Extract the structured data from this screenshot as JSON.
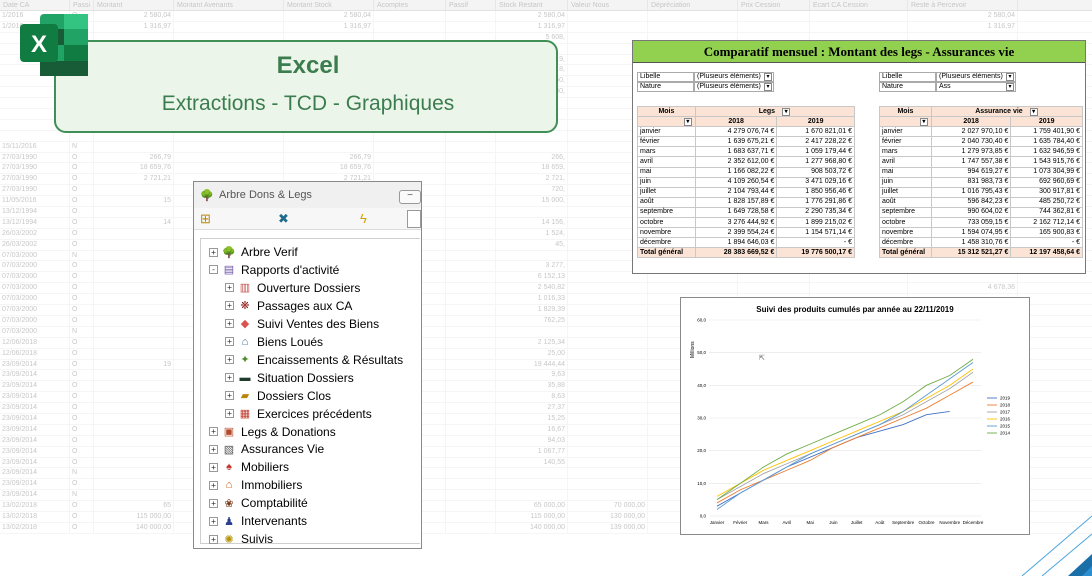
{
  "background_sheet": {
    "headers": [
      "Date CA",
      "Passi",
      "Montant",
      "Montant Avenants",
      "Montant Stock",
      "Acomptes",
      "Passif",
      "Stock Restant",
      "Valeur Nous",
      "Dépréciation",
      "Prix Cession",
      "Ecart CA Cession",
      "Reste à Percevoir"
    ],
    "rows": [
      [
        "1/2016",
        "O",
        "2 580,04",
        "",
        "2 580,04",
        "",
        "",
        "2 580,04",
        "",
        "",
        "",
        "",
        "2 580,04"
      ],
      [
        "1/2016",
        "O",
        "1 316,97",
        "",
        "1 316,97",
        "",
        "",
        "1 316,97",
        "",
        "",
        "",
        "",
        "1 316,97"
      ],
      [
        "",
        "",
        "",
        "",
        "",
        "",
        "",
        "5 608,",
        "",
        "",
        "",
        "",
        ""
      ],
      [
        "",
        "",
        "",
        "",
        "",
        "",
        "",
        "",
        "",
        "",
        "",
        "",
        ""
      ],
      [
        "",
        "",
        "",
        "",
        "",
        "",
        "",
        "19,",
        "",
        "",
        "",
        "",
        ""
      ],
      [
        "",
        "",
        "",
        "",
        "",
        "",
        "",
        "8,",
        "",
        "",
        "",
        "",
        ""
      ],
      [
        "",
        "",
        "",
        "",
        "",
        "",
        "",
        "850,",
        "",
        "",
        "",
        "",
        ""
      ],
      [
        "",
        "",
        "",
        "",
        "",
        "",
        "",
        "530,",
        "",
        "",
        "",
        "",
        ""
      ],
      [
        "",
        "",
        "",
        "",
        "",
        "",
        "",
        "",
        "",
        "",
        "",
        "",
        ""
      ],
      [
        "",
        "",
        "",
        "",
        "",
        "",
        "",
        "",
        "",
        "",
        "",
        "",
        ""
      ],
      [
        "",
        "",
        "",
        "",
        "",
        "",
        "",
        "",
        "",
        "",
        "",
        "",
        ""
      ],
      [
        "",
        "",
        "",
        "",
        "",
        "",
        "",
        "",
        "",
        "",
        "",
        "",
        ""
      ],
      [
        "15/11/2016",
        "N",
        "",
        "",
        "",
        "",
        "",
        "",
        "",
        "",
        "",
        "",
        ""
      ],
      [
        "27/03/1990",
        "O",
        "266,79",
        "",
        "266,79",
        "",
        "",
        "266,",
        "",
        "",
        "",
        "",
        ""
      ],
      [
        "27/03/1990",
        "O",
        "18 659,76",
        "",
        "18 659,76",
        "",
        "",
        "18 659,",
        "",
        "",
        "",
        "",
        ""
      ],
      [
        "27/03/1990",
        "O",
        "2 721,21",
        "",
        "2 721,21",
        "",
        "",
        "2 721,",
        "",
        "",
        "",
        "",
        ""
      ],
      [
        "27/03/1990",
        "O",
        "",
        "",
        "",
        "",
        "",
        "720,",
        "",
        "",
        "",
        "",
        ""
      ],
      [
        "11/05/2016",
        "O",
        "15",
        "",
        "",
        "",
        "",
        "15 000,",
        "",
        "",
        "",
        "",
        ""
      ],
      [
        "13/12/1994",
        "O",
        "",
        "",
        "",
        "",
        "",
        "",
        "",
        "",
        "",
        "",
        ""
      ],
      [
        "13/12/1994",
        "O",
        "14",
        "",
        "",
        "",
        "",
        "14 156,",
        "",
        "",
        "",
        "",
        ""
      ],
      [
        "26/03/2002",
        "O",
        "",
        "",
        "",
        "",
        "",
        "1 524,",
        "",
        "",
        "",
        "",
        ""
      ],
      [
        "26/03/2002",
        "O",
        "",
        "",
        "",
        "",
        "",
        "45,",
        "",
        "",
        "",
        "",
        ""
      ],
      [
        "07/03/2000",
        "N",
        "",
        "",
        "",
        "",
        "",
        "",
        "",
        "",
        "",
        "",
        ""
      ],
      [
        "07/03/2000",
        "O",
        "",
        "",
        "",
        "",
        "",
        "3 277,",
        "",
        "",
        "",
        "",
        ""
      ],
      [
        "07/03/2000",
        "O",
        "",
        "",
        "",
        "",
        "",
        "6 152,13",
        "",
        "",
        "",
        "",
        ""
      ],
      [
        "07/03/2000",
        "O",
        "",
        "",
        "",
        "",
        "",
        "2 540,82",
        "",
        "",
        "",
        "",
        "4 678,36"
      ],
      [
        "07/03/2000",
        "O",
        "",
        "",
        "",
        "",
        "",
        "1 016,33",
        "",
        "",
        "",
        "",
        ""
      ],
      [
        "07/03/2000",
        "O",
        "",
        "",
        "",
        "",
        "",
        "1 829,39",
        "",
        "",
        "",
        "",
        "3 562,55"
      ],
      [
        "07/03/2000",
        "O",
        "",
        "",
        "",
        "",
        "",
        "762,25",
        "",
        "",
        "",
        "",
        "1 930,45"
      ],
      [
        "07/03/2000",
        "N",
        "",
        "",
        "",
        "",
        "",
        "",
        "",
        "",
        "",
        "",
        "2 408,33"
      ],
      [
        "12/06/2018",
        "O",
        "",
        "",
        "",
        "",
        "",
        "2 125,34",
        "",
        "",
        "",
        "",
        "2 125,34"
      ],
      [
        "12/06/2018",
        "O",
        "",
        "",
        "",
        "",
        "",
        "25,00",
        "",
        "",
        "",
        "",
        ""
      ],
      [
        "23/09/2014",
        "O",
        "19",
        "",
        "",
        "",
        "",
        "19 444,44",
        "",
        "",
        "",
        "",
        "15 555,55"
      ],
      [
        "23/09/2014",
        "O",
        "",
        "",
        "",
        "",
        "",
        "9,63",
        "",
        "",
        "",
        "",
        "9,63"
      ],
      [
        "23/09/2014",
        "O",
        "",
        "",
        "",
        "",
        "",
        "35,88",
        "",
        "",
        "",
        "",
        "35,88"
      ],
      [
        "23/09/2014",
        "O",
        "",
        "",
        "",
        "",
        "",
        "8,63",
        "",
        "",
        "",
        "",
        "8,63"
      ],
      [
        "23/09/2014",
        "O",
        "",
        "",
        "",
        "",
        "",
        "27,37",
        "",
        "",
        "",
        "",
        "27,37"
      ],
      [
        "23/09/2014",
        "O",
        "",
        "",
        "",
        "",
        "",
        "15,25",
        "",
        "",
        "",
        "",
        "15,25"
      ],
      [
        "23/09/2014",
        "O",
        "",
        "",
        "",
        "",
        "",
        "16,67",
        "",
        "",
        "",
        "",
        "16,67"
      ],
      [
        "23/09/2014",
        "O",
        "",
        "",
        "",
        "",
        "",
        "94,03",
        "",
        "",
        "",
        "",
        "94,03"
      ],
      [
        "23/09/2014",
        "O",
        "",
        "",
        "",
        "",
        "",
        "1 067,77",
        "",
        "",
        "",
        "",
        "1 067,77"
      ],
      [
        "23/09/2014",
        "O",
        "",
        "",
        "",
        "",
        "",
        "140,55",
        "",
        "",
        "",
        "",
        "140,55"
      ],
      [
        "23/09/2014",
        "N",
        "",
        "",
        "",
        "",
        "",
        "",
        "",
        "",
        "",
        "",
        ""
      ],
      [
        "23/09/2014",
        "O",
        "",
        "",
        "",
        "",
        "",
        "",
        "",
        "",
        "",
        "",
        "4 873,37"
      ],
      [
        "23/09/2014",
        "N",
        "",
        "",
        "",
        "",
        "",
        "",
        "",
        "",
        "",
        "",
        ""
      ],
      [
        "13/02/2018",
        "O",
        "65",
        "",
        "",
        "",
        "",
        "65 000,00",
        "70 000,00",
        "",
        "",
        "",
        "70 000,00"
      ],
      [
        "13/02/2018",
        "O",
        "115 000,00",
        "",
        "115 000,00",
        "",
        "",
        "115 000,00",
        "130 000,00",
        "",
        "",
        "",
        "130 000,00"
      ],
      [
        "13/02/2018",
        "O",
        "140 000,00",
        "",
        "140 000,00",
        "",
        "",
        "140 000,00",
        "139 000,00",
        "",
        "1 000,00",
        "",
        "139 000,00"
      ]
    ]
  },
  "banner": {
    "title": "Excel",
    "subtitle": "Extractions - TCD - Graphiques",
    "icon_letter": "X",
    "icon": "excel-icon"
  },
  "comparatif": {
    "title": "Comparatif  mensuel : Montant des legs - Assurances vie",
    "left": {
      "filters": [
        {
          "label": "Libelle",
          "value": "(Plusieurs éléments)"
        },
        {
          "label": "Nature",
          "value": "(Plusieurs éléments)"
        }
      ],
      "col_mois": "Mois",
      "col_value": "Legs",
      "years": [
        "2018",
        "2019"
      ],
      "rows": [
        [
          "janvier",
          "4 279 076,74 €",
          "1 670 821,01 €"
        ],
        [
          "février",
          "1 639 675,21 €",
          "2 417 228,22 €"
        ],
        [
          "mars",
          "1 683 637,71 €",
          "1 059 179,44 €"
        ],
        [
          "avril",
          "2 352 612,00 €",
          "1 277 968,80 €"
        ],
        [
          "mai",
          "1 166 082,22 €",
          "908 503,72 €"
        ],
        [
          "juin",
          "4 109 260,54 €",
          "3 471 029,16 €"
        ],
        [
          "juillet",
          "2 104 793,44 €",
          "1 850 956,46 €"
        ],
        [
          "août",
          "1 828 157,89 €",
          "1 776 291,86 €"
        ],
        [
          "septembre",
          "1 649 728,58 €",
          "2 290 735,34 €"
        ],
        [
          "octobre",
          "3 276 444,92 €",
          "1 899 215,02 €"
        ],
        [
          "novembre",
          "2 399 554,24 €",
          "1 154 571,14 €"
        ],
        [
          "décembre",
          "1 894 646,03 €",
          "-   €"
        ]
      ],
      "total_label": "Total général",
      "totals": [
        "28 383 669,52 €",
        "19 776 500,17 €"
      ]
    },
    "right": {
      "filters": [
        {
          "label": "Libelle",
          "value": "(Plusieurs éléments)"
        },
        {
          "label": "Nature",
          "value": "Ass"
        }
      ],
      "col_mois": "Mois",
      "col_value": "Assurance vie",
      "years": [
        "2018",
        "2019"
      ],
      "rows": [
        [
          "janvier",
          "2 027 970,10 €",
          "1 759 401,90 €"
        ],
        [
          "février",
          "2 040 730,40 €",
          "1 635 784,40 €"
        ],
        [
          "mars",
          "1 279 973,85 €",
          "1 632 946,59 €"
        ],
        [
          "avril",
          "1 747 557,38 €",
          "1 543 915,76 €"
        ],
        [
          "mai",
          "994 619,27 €",
          "1 073 304,99 €"
        ],
        [
          "juin",
          "831 983,73 €",
          "692 960,69 €"
        ],
        [
          "juillet",
          "1 016 795,43 €",
          "300 917,81 €"
        ],
        [
          "août",
          "596 842,23 €",
          "485 250,72 €"
        ],
        [
          "septembre",
          "990 604,02 €",
          "744 362,81 €"
        ],
        [
          "octobre",
          "733 059,15 €",
          "2 162 712,14 €"
        ],
        [
          "novembre",
          "1 594 074,95 €",
          "165 900,83 €"
        ],
        [
          "décembre",
          "1 458 310,76 €",
          "-   €"
        ]
      ],
      "total_label": "Total général",
      "totals": [
        "15 312 521,27 €",
        "12 197 458,64 €"
      ]
    }
  },
  "chart_data": {
    "type": "line",
    "title": "Suivi des produits cumulés par année au 22/11/2019",
    "ylabel": "Millions",
    "xlabel": "",
    "categories": [
      "Janvier",
      "Février",
      "Mars",
      "Avril",
      "Mai",
      "Juin",
      "Juillet",
      "Août",
      "Septembre",
      "Octobre",
      "Novembre",
      "Décembre"
    ],
    "ylim": [
      0,
      60
    ],
    "yticks": [
      "0,0",
      "10,0",
      "20,0",
      "30,0",
      "40,0",
      "50,0",
      "60,0"
    ],
    "legend_position": "right",
    "series": [
      {
        "name": "2019",
        "color": "#4472c4",
        "values": [
          3,
          7,
          11,
          15,
          18,
          21,
          24,
          26,
          28,
          31,
          32,
          null
        ]
      },
      {
        "name": "2018",
        "color": "#ed7d31",
        "values": [
          4,
          8,
          11,
          14,
          17,
          21,
          24,
          27,
          30,
          33,
          37,
          41
        ]
      },
      {
        "name": "2017",
        "color": "#a5a5a5",
        "values": [
          5,
          9,
          13,
          16,
          19,
          22,
          25,
          28,
          31,
          35,
          39,
          44
        ]
      },
      {
        "name": "2016",
        "color": "#ffc000",
        "values": [
          6,
          10,
          14,
          17,
          20,
          23,
          26,
          29,
          32,
          36,
          40,
          45
        ]
      },
      {
        "name": "2015",
        "color": "#5b9bd5",
        "values": [
          2,
          7,
          11,
          15,
          19,
          22,
          25,
          28,
          32,
          37,
          42,
          47
        ]
      },
      {
        "name": "2014",
        "color": "#70ad47",
        "values": [
          5,
          10,
          15,
          19,
          22,
          25,
          28,
          31,
          35,
          40,
          43,
          48
        ]
      }
    ]
  },
  "tree_window": {
    "title": "Arbre Dons & Legs",
    "items": [
      {
        "label": "Arbre Verif",
        "level": 0,
        "expander": "+",
        "icon": "tree-icon",
        "color": "#2e7d32"
      },
      {
        "label": "Rapports d'activité",
        "level": 0,
        "expander": "-",
        "icon": "report-icon",
        "color": "#6a4fa3"
      },
      {
        "label": "Ouverture Dossiers",
        "level": 1,
        "expander": "+",
        "icon": "folder-open-icon",
        "color": "#c0504d"
      },
      {
        "label": "Passages aux CA",
        "level": 1,
        "expander": "+",
        "icon": "group-icon",
        "color": "#8e1b1b"
      },
      {
        "label": "Suivi Ventes des Biens",
        "level": 1,
        "expander": "+",
        "icon": "sales-icon",
        "color": "#d9534f"
      },
      {
        "label": "Biens Loués",
        "level": 1,
        "expander": "+",
        "icon": "house-icon",
        "color": "#3d6d8e"
      },
      {
        "label": "Encaissements & Résultats",
        "level": 1,
        "expander": "+",
        "icon": "cash-icon",
        "color": "#4f8a2c"
      },
      {
        "label": "Situation Dossiers",
        "level": 1,
        "expander": "+",
        "icon": "screen-icon",
        "color": "#1f3b2b"
      },
      {
        "label": "Dossiers Clos",
        "level": 1,
        "expander": "+",
        "icon": "closed-folder-icon",
        "color": "#b8860b"
      },
      {
        "label": "Exercices précédents",
        "level": 1,
        "expander": "+",
        "icon": "calendar-icon",
        "color": "#c0392b"
      },
      {
        "label": "Legs & Donations",
        "level": 0,
        "expander": "+",
        "icon": "gift-icon",
        "color": "#b34a2a"
      },
      {
        "label": "Assurances Vie",
        "level": 0,
        "expander": "+",
        "icon": "document-icon",
        "color": "#555555"
      },
      {
        "label": "Mobiliers",
        "level": 0,
        "expander": "+",
        "icon": "furniture-icon",
        "color": "#c0392b"
      },
      {
        "label": "Immobiliers",
        "level": 0,
        "expander": "+",
        "icon": "building-icon",
        "color": "#d35400"
      },
      {
        "label": "Comptabilité",
        "level": 0,
        "expander": "+",
        "icon": "accounting-icon",
        "color": "#7d3c1a"
      },
      {
        "label": "Intervenants",
        "level": 0,
        "expander": "+",
        "icon": "people-icon",
        "color": "#2c3e91"
      },
      {
        "label": "Suivis",
        "level": 0,
        "expander": "+",
        "icon": "track-icon",
        "color": "#b7950b"
      }
    ]
  }
}
